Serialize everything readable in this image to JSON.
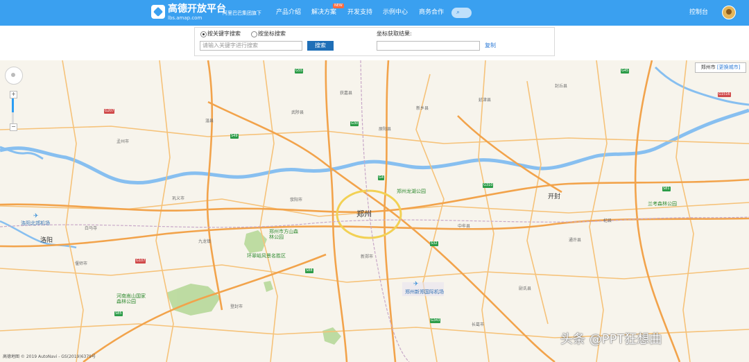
{
  "header": {
    "logo_title": "高德开放平台",
    "logo_subtitle": "lbs.amap.com",
    "group_label": "阿里巴巴集团旗下",
    "nav": [
      "产品介绍",
      "解决方案",
      "开发支持",
      "示例中心",
      "商务合作"
    ],
    "new_badge": "NEW",
    "search_icon": "search-icon",
    "console": "控制台"
  },
  "search": {
    "mode_keyword": "按关键字搜索",
    "mode_coord": "按坐标搜索",
    "keyword_placeholder": "请输入关键字进行搜索",
    "search_button": "搜索",
    "coord_result_label": "坐标获取结果:",
    "copy_link": "复制"
  },
  "map": {
    "city_box_city": "郑州市",
    "city_box_link": "[更换城市]",
    "cities": [
      "郑州",
      "开封",
      "洛阳"
    ],
    "parks": [
      "郑州龙湖公园",
      "郑州市方山森林公园",
      "环翠峪风景名胜区",
      "河南嵩山国家森林公园",
      "兰考森林公园",
      "洛阳北郊机场",
      "郑州新郑国际机场"
    ],
    "districts": [
      "九龙镇",
      "白马寺",
      "新郑市",
      "中牟县",
      "尉氏县",
      "长葛市",
      "登封市",
      "偃师市",
      "荥阳市",
      "原阳县",
      "新乡县",
      "通许县",
      "杞县",
      "巩义市",
      "孟州市",
      "温县",
      "武陟县",
      "获嘉县",
      "延津县",
      "封丘县"
    ],
    "road_shields": [
      "G30",
      "G4",
      "S32",
      "G107",
      "G310",
      "G207",
      "S85",
      "G55",
      "G45",
      "S88",
      "G1516",
      "S49",
      "G343",
      "S81"
    ],
    "copyright": "高德地图 © 2019 AutoNavi - GS(2019)6379号",
    "zoom_in": "+",
    "zoom_out": "−"
  },
  "watermark": "头条 @PPT狂想曲",
  "colors": {
    "header_bg": "#3aa0f0",
    "search_button": "#1f6fb7",
    "river": "#87bff0",
    "expressway": "#f2a34b",
    "road": "#f6c279",
    "green": "#a8d07e"
  }
}
